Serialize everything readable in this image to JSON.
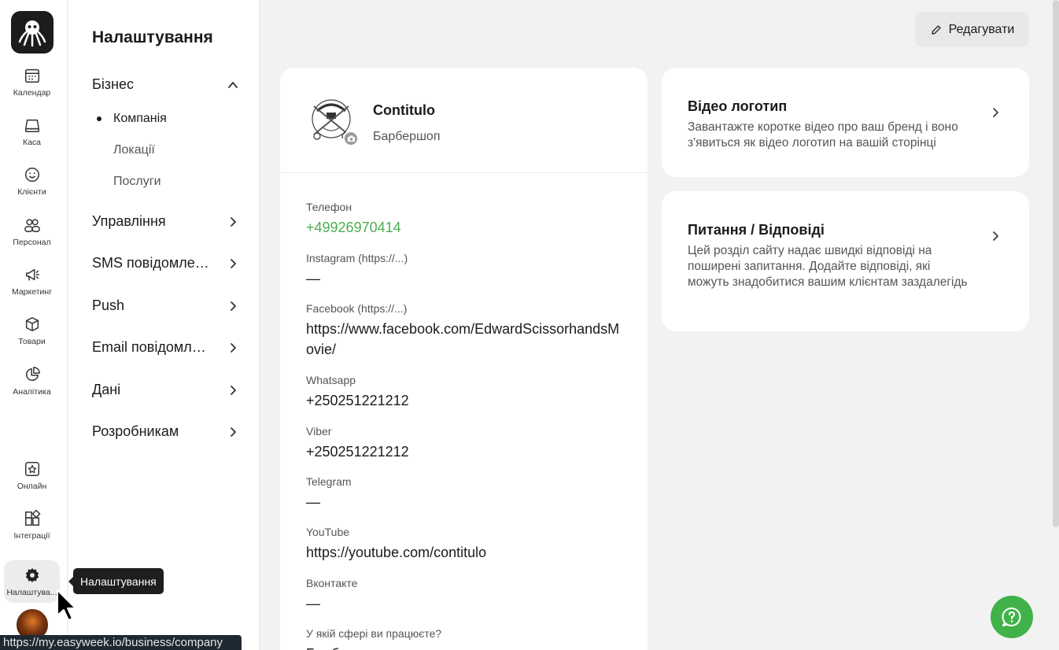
{
  "rail": {
    "items": [
      {
        "label": "Календар",
        "icon": "calendar-icon"
      },
      {
        "label": "Каса",
        "icon": "cash-register-icon"
      },
      {
        "label": "Клієнти",
        "icon": "smiley-icon"
      },
      {
        "label": "Персонал",
        "icon": "staff-icon"
      },
      {
        "label": "Маркетинг",
        "icon": "megaphone-icon"
      },
      {
        "label": "Товари",
        "icon": "box-icon"
      },
      {
        "label": "Аналітика",
        "icon": "pie-chart-icon"
      },
      {
        "label": "Онлайн",
        "icon": "star-calendar-icon"
      },
      {
        "label": "Інтеграції",
        "icon": "integrations-icon"
      },
      {
        "label": "Налаштува...",
        "icon": "gear-icon"
      }
    ],
    "tooltip": "Налаштування"
  },
  "status_url": "https://my.easyweek.io/business/company",
  "menu": {
    "title": "Налаштування",
    "business": {
      "label": "Бізнес",
      "sub": [
        "Компанія",
        "Локації",
        "Послуги"
      ]
    },
    "sections": [
      "Управління",
      "SMS повідомлення",
      "Push",
      "Email повідомлення",
      "Дані",
      "Розробникам"
    ]
  },
  "edit_label": "Редагувати",
  "company": {
    "name": "Contitulo",
    "type": "Барбершоп",
    "fields": [
      {
        "label": "Телефон",
        "value": "+49926970414"
      },
      {
        "label": "Instagram (https://...)",
        "value": "—"
      },
      {
        "label": "Facebook (https://...)",
        "value": "https://www.facebook.com/EdwardScissorhandsMovie/"
      },
      {
        "label": "Whatsapp",
        "value": "+250251221212"
      },
      {
        "label": "Viber",
        "value": "+250251221212"
      },
      {
        "label": "Telegram",
        "value": "—"
      },
      {
        "label": "YouTube",
        "value": "https://youtube.com/contitulo"
      },
      {
        "label": "Вконтакте",
        "value": "—"
      },
      {
        "label": "У якій сфері ви працюєте?",
        "value": "Барбершоп"
      }
    ]
  },
  "video_logo": {
    "title": "Відео логотип",
    "desc": "Завантажте коротке відео про ваш бренд і воно з'явиться як відео логотип на вашій сторінці"
  },
  "faq": {
    "title": "Питання / Відповіді",
    "desc": "Цей розділ сайту надає швидкі відповіді на поширені запитання. Додайте відповіді, які можуть знадобитися вашим клієнтам заздалегідь"
  },
  "colors": {
    "accent_green": "#41b249",
    "phone_green": "#4caf50"
  }
}
